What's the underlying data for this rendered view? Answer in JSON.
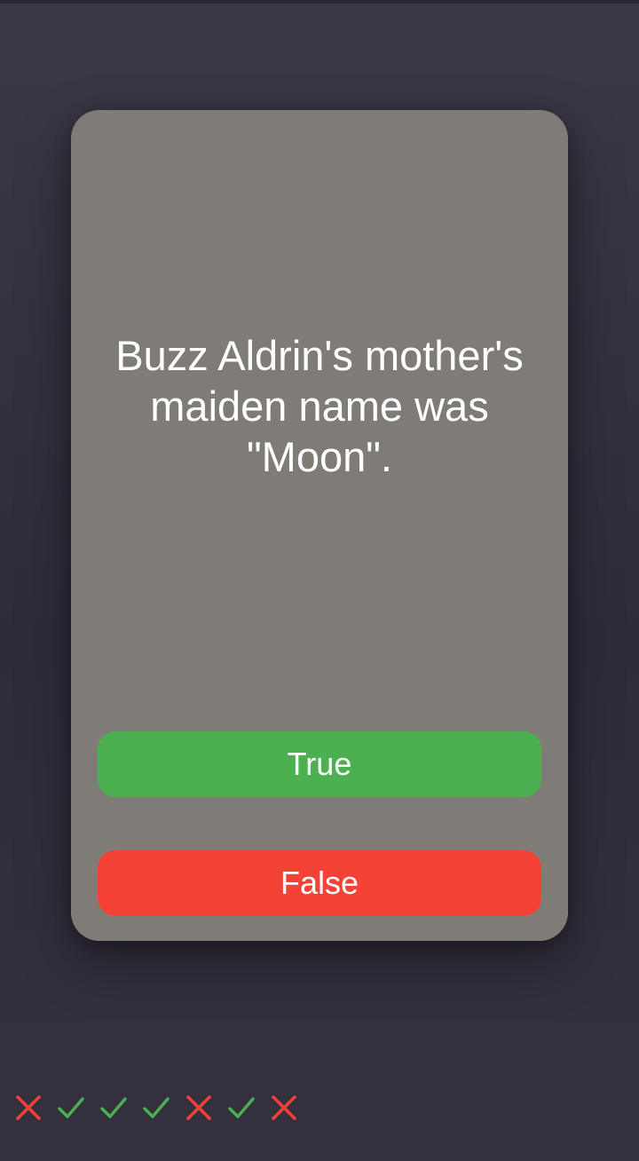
{
  "card": {
    "question": "Buzz Aldrin's mother's maiden name was \"Moon\".",
    "true_label": "True",
    "false_label": "False"
  },
  "answer_history": [
    "wrong",
    "correct",
    "correct",
    "correct",
    "wrong",
    "correct",
    "wrong"
  ],
  "colors": {
    "correct": "#4caf50",
    "wrong": "#f44336",
    "card": "#7f7c78",
    "background": "#35313f"
  },
  "icons": {
    "correct": "check-icon",
    "wrong": "cross-icon"
  }
}
